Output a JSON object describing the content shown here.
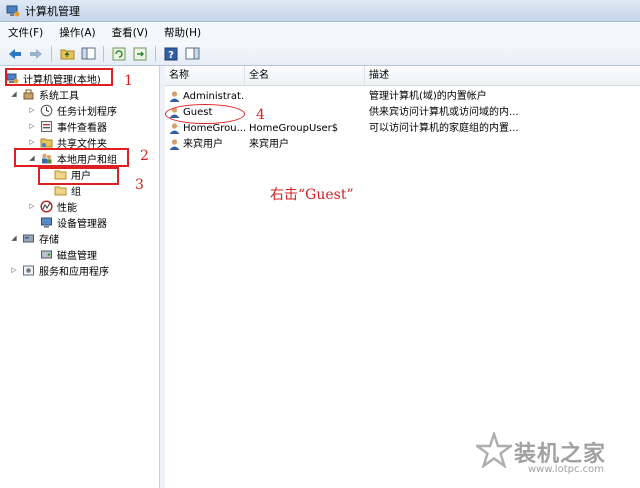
{
  "window": {
    "title": "计算机管理"
  },
  "menu": [
    "文件(F)",
    "操作(A)",
    "查看(V)",
    "帮助(H)"
  ],
  "tree": {
    "root": "计算机管理(本地)",
    "system_tools": "系统工具",
    "task_scheduler": "任务计划程序",
    "event_viewer": "事件查看器",
    "shared_folders": "共享文件夹",
    "local_users_groups": "本地用户和组",
    "users": "用户",
    "groups": "组",
    "performance": "性能",
    "device_manager": "设备管理器",
    "storage": "存储",
    "disk_management": "磁盘管理",
    "services_apps": "服务和应用程序"
  },
  "list": {
    "headers": [
      "名称",
      "全名",
      "描述"
    ],
    "rows": [
      {
        "name": "Administrat...",
        "fullname": "",
        "desc": "管理计算机(域)的内置帐户"
      },
      {
        "name": "Guest",
        "fullname": "",
        "desc": "供来宾访问计算机或访问域的内..."
      },
      {
        "name": "HomeGrou...",
        "fullname": "HomeGroupUser$",
        "desc": "可以访问计算机的家庭组的内置..."
      },
      {
        "name": "来宾用户",
        "fullname": "来宾用户",
        "desc": ""
      }
    ]
  },
  "annotations": {
    "n1": "1",
    "n2": "2",
    "n3": "3",
    "n4": "4",
    "instruction": "右击“Guest”",
    "color": "#e02020"
  },
  "watermark": {
    "title": "装机之家",
    "url": "www.lotpc.com"
  }
}
